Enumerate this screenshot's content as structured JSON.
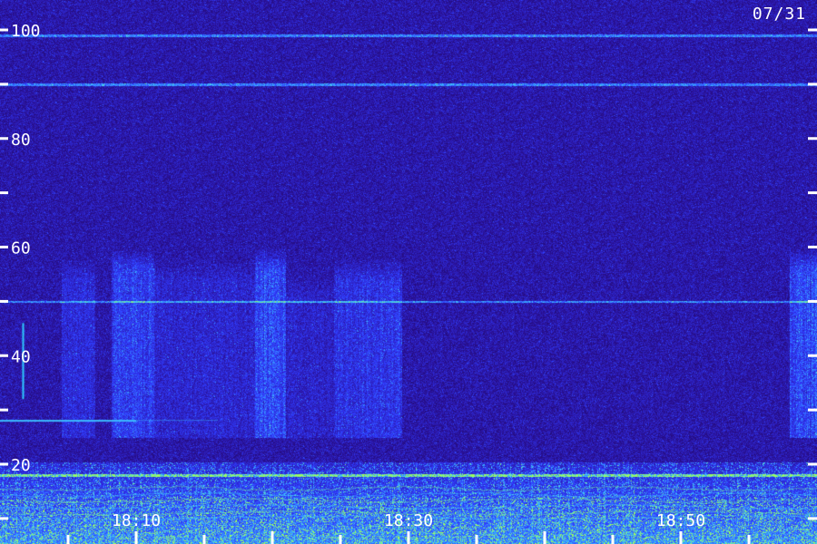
{
  "date": "07/31",
  "chart_data": {
    "type": "heatmap",
    "title": "",
    "xlabel": "",
    "ylabel": "",
    "ylim": [
      0,
      100
    ],
    "xlim": [
      "18:00",
      "18:60"
    ],
    "y_ticks_labeled": [
      20,
      40,
      60,
      80,
      100
    ],
    "y_ticks_minor": [
      10,
      30,
      50,
      70,
      90
    ],
    "x_ticks_labeled": [
      "18:10",
      "18:30",
      "18:50"
    ],
    "x_tick_minutes": [
      5,
      10,
      15,
      20,
      25,
      30,
      35,
      40,
      45,
      50,
      55
    ],
    "grid": false,
    "colors": {
      "background": "#1c0a5a",
      "low": "#2a10a0",
      "mid": "#2f46ff",
      "high": "#3cd0ff",
      "peak": "#9cff5a"
    },
    "features": {
      "horizontal_lines_y": [
        99,
        90,
        50
      ],
      "green_band_y": 18,
      "strong_band_y_max": 14,
      "bursts": [
        {
          "t_start": 4.5,
          "t_end": 7,
          "y_low": 25,
          "y_high": 58,
          "level": 0.45
        },
        {
          "t_start": 8.2,
          "t_end": 11.3,
          "y_low": 25,
          "y_high": 60,
          "level": 0.75
        },
        {
          "t_start": 11.3,
          "t_end": 18.7,
          "y_low": 25,
          "y_high": 58,
          "level": 0.35
        },
        {
          "t_start": 18.7,
          "t_end": 21,
          "y_low": 25,
          "y_high": 60,
          "level": 0.85
        },
        {
          "t_start": 21,
          "t_end": 24.5,
          "y_low": 25,
          "y_high": 55,
          "level": 0.3
        },
        {
          "t_start": 24.5,
          "t_end": 29.5,
          "y_low": 25,
          "y_high": 58,
          "level": 0.6
        },
        {
          "t_start": 58,
          "t_end": 60,
          "y_low": 25,
          "y_high": 60,
          "level": 0.9
        }
      ],
      "trace_segment": {
        "t_start": 0,
        "t_end": 10,
        "y": 28
      },
      "short_vertical": {
        "t": 1.7,
        "y_low": 32,
        "y_high": 46
      }
    }
  }
}
